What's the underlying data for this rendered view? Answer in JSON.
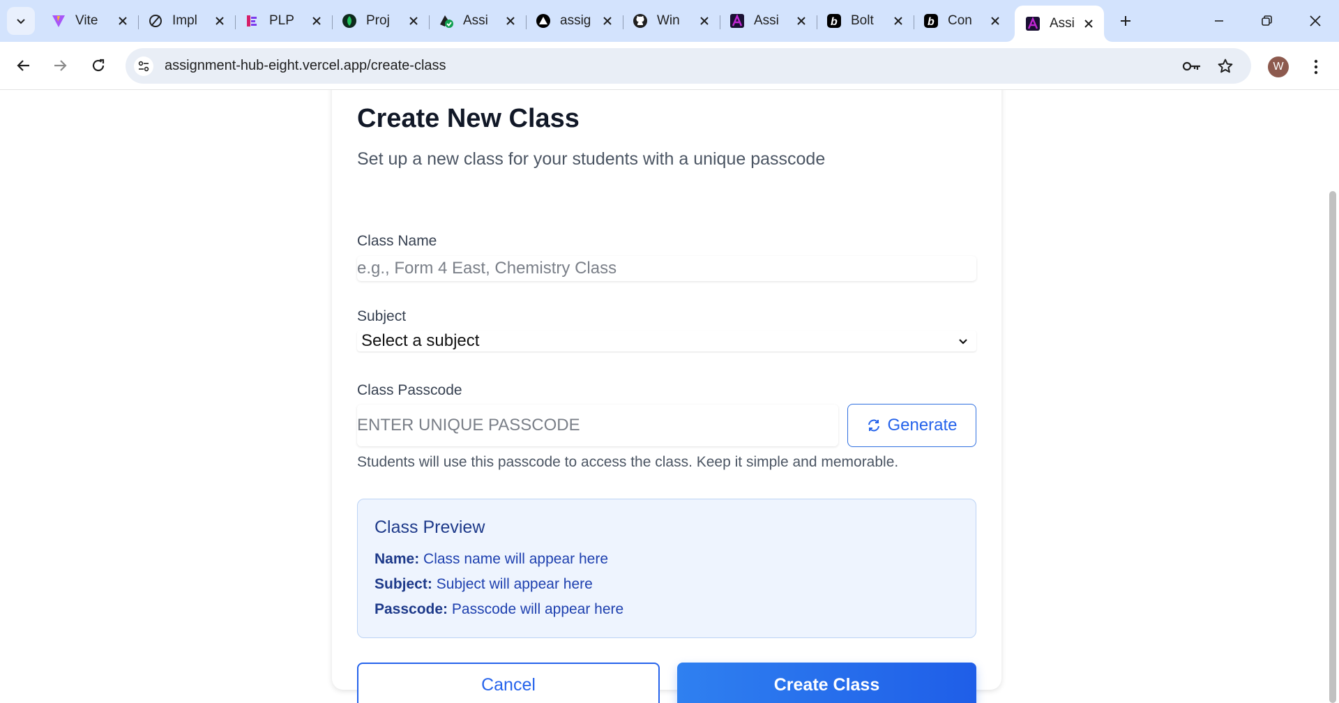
{
  "browser": {
    "tabs": [
      {
        "title": "Vite",
        "favicon": "vite-icon",
        "color": "#a855f7"
      },
      {
        "title": "Impl",
        "favicon": "slash-circle-icon",
        "color": "#1f1f1f"
      },
      {
        "title": "PLP",
        "favicon": "plp-logo-icon",
        "color": "#d61f69"
      },
      {
        "title": "Proj",
        "favicon": "leaf-icon",
        "color": "#1f6e43"
      },
      {
        "title": "Assi",
        "favicon": "check-badge-icon",
        "color": "#12a150"
      },
      {
        "title": "assig",
        "favicon": "triangle-icon",
        "color": "#000000"
      },
      {
        "title": "Win",
        "favicon": "github-icon",
        "color": "#1f1f1f"
      },
      {
        "title": "Assi",
        "favicon": "assignment-hub-icon",
        "color": "#7c3aed"
      },
      {
        "title": "Bolt",
        "favicon": "bolt-icon",
        "color": "#000000"
      },
      {
        "title": "Con",
        "favicon": "bolt-icon",
        "color": "#000000"
      },
      {
        "title": "Assi",
        "favicon": "assignment-hub-icon",
        "color": "#7c3aed",
        "active": true
      }
    ],
    "url": "assignment-hub-eight.vercel.app/create-class",
    "profile_initial": "W"
  },
  "page": {
    "title": "Create New Class",
    "subtitle": "Set up a new class for your students with a unique passcode",
    "class_name": {
      "label": "Class Name",
      "placeholder": "e.g., Form 4 East, Chemistry Class",
      "value": ""
    },
    "subject": {
      "label": "Subject",
      "selected": "Select a subject"
    },
    "passcode": {
      "label": "Class Passcode",
      "placeholder": "ENTER UNIQUE PASSCODE",
      "value": "",
      "generate_label": "Generate",
      "help": "Students will use this passcode to access the class. Keep it simple and memorable."
    },
    "preview": {
      "title": "Class Preview",
      "name_key": "Name:",
      "name_val": "Class name will appear here",
      "subject_key": "Subject:",
      "subject_val": "Subject will appear here",
      "passcode_key": "Passcode:",
      "passcode_val": "Passcode will appear here"
    },
    "actions": {
      "cancel": "Cancel",
      "create": "Create Class"
    }
  },
  "colors": {
    "accent": "#2563eb",
    "tabstrip": "#d3e3fd",
    "preview_bg": "#eef4fe"
  }
}
